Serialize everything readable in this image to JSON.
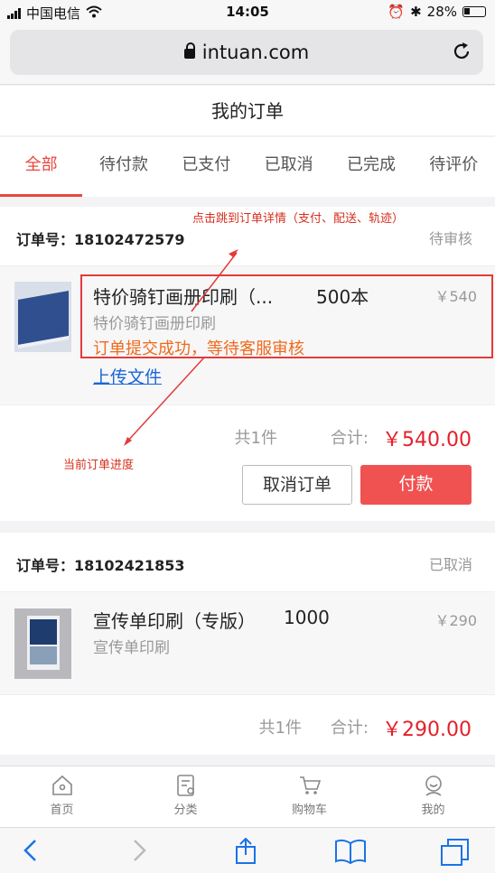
{
  "status_bar": {
    "carrier": "中国电信",
    "time": "14:05",
    "battery": "28%"
  },
  "browser": {
    "host": "intuan.com"
  },
  "page": {
    "title": "我的订单"
  },
  "tabs": [
    {
      "label": "全部",
      "active": true
    },
    {
      "label": "待付款"
    },
    {
      "label": "已支付"
    },
    {
      "label": "已取消"
    },
    {
      "label": "已完成"
    },
    {
      "label": "待评价"
    }
  ],
  "orders": [
    {
      "order_no": "订单号：18102472579",
      "state": "待审核",
      "item": {
        "name": "特价骑钉画册印刷（...",
        "qty": "500本",
        "price": "￥540",
        "category": "特价骑钉画册印刷",
        "progress": "订单提交成功，等待客服审核",
        "upload_label": "上传文件"
      },
      "count": "共1件",
      "total_label": "合计:",
      "total": "￥540.00",
      "cancel_label": "取消订单",
      "pay_label": "付款"
    },
    {
      "order_no": "订单号：18102421853",
      "state": "已取消",
      "item": {
        "name": "宣传单印刷（专版）",
        "qty": "1000",
        "price": "￥290",
        "category": "宣传单印刷"
      },
      "count": "共1件",
      "total_label": "合计:",
      "total": "￥290.00"
    }
  ],
  "annotations": {
    "detail_note": "点击跳到订单详情（支付、配送、轨迹）",
    "progress_note": "当前订单进度"
  },
  "bottom_nav": [
    {
      "label": "首页",
      "icon": "home-icon"
    },
    {
      "label": "分类",
      "icon": "category-icon"
    },
    {
      "label": "购物车",
      "icon": "cart-icon"
    },
    {
      "label": "我的",
      "icon": "profile-icon"
    }
  ],
  "colors": {
    "accent": "#e9483d",
    "pay": "#f05252",
    "total": "#e3202b",
    "progress": "#f06a1c",
    "annotation": "#e23b3b"
  }
}
